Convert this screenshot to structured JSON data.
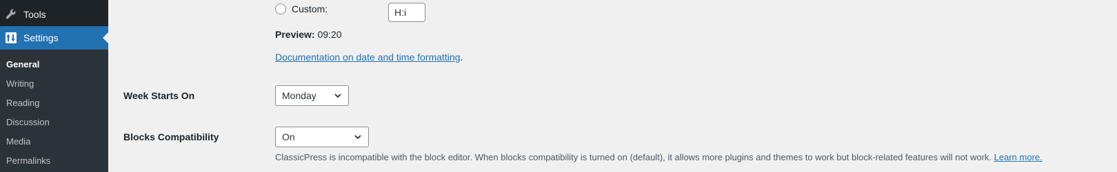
{
  "sidebar": {
    "tools_label": "Tools",
    "settings_label": "Settings",
    "submenu": [
      {
        "label": "General"
      },
      {
        "label": "Writing"
      },
      {
        "label": "Reading"
      },
      {
        "label": "Discussion"
      },
      {
        "label": "Media"
      },
      {
        "label": "Permalinks"
      }
    ]
  },
  "time_format": {
    "custom_label": "Custom:",
    "custom_value": "H:i",
    "preview_label": "Preview:",
    "preview_value": "09:20",
    "doc_link": "Documentation on date and time formatting",
    "doc_link_suffix": "."
  },
  "week_starts_on": {
    "label": "Week Starts On",
    "value": "Monday"
  },
  "blocks_compatibility": {
    "label": "Blocks Compatibility",
    "value": "On",
    "description": "ClassicPress is incompatible with the block editor. When blocks compatibility is turned on (default), it allows more plugins and themes to work but block-related features will not work.",
    "learn_more": "Learn more."
  },
  "colors": {
    "sidebar_bg": "#1d2327",
    "submenu_bg": "#2c3338",
    "accent": "#2271b1",
    "page_bg": "#f0f0f1"
  }
}
